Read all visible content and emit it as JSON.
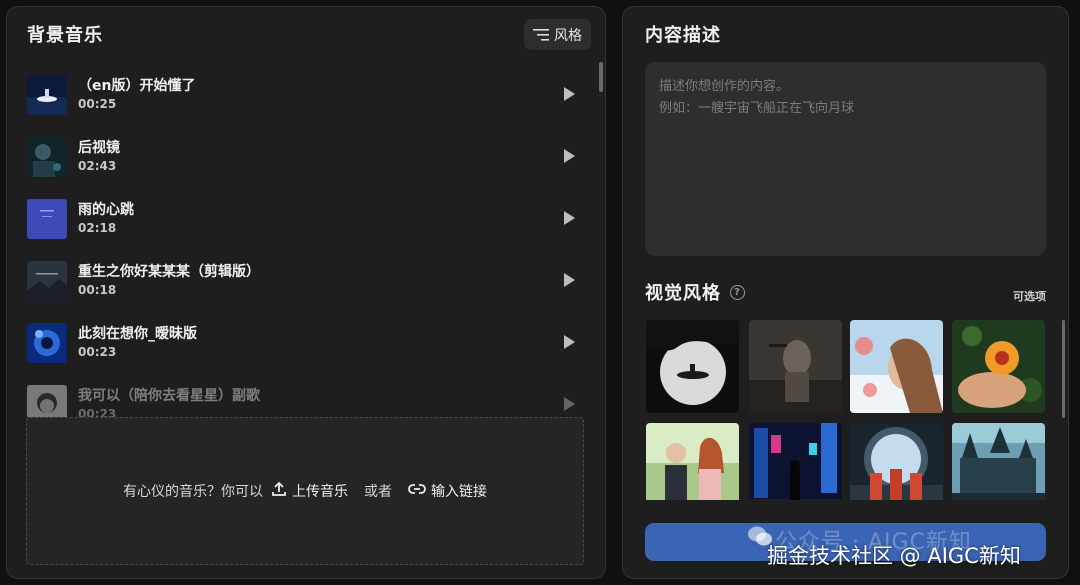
{
  "background_music": {
    "title": "背景音乐",
    "style_button_label": "风格",
    "items": [
      {
        "title": "（en版）开始懂了",
        "duration": "00:25"
      },
      {
        "title": "后视镜",
        "duration": "02:43"
      },
      {
        "title": "雨的心跳",
        "duration": "02:18"
      },
      {
        "title": "重生之你好某某某（剪辑版）",
        "duration": "00:18"
      },
      {
        "title": "此刻在想你_暧昧版",
        "duration": "00:23"
      },
      {
        "title": "我可以（陪你去看星星）副歌",
        "duration": "00:23"
      }
    ],
    "upload": {
      "prompt": "有心仪的音乐？你可以",
      "upload_label": "上传音乐",
      "or_label": "或者",
      "link_label": "输入链接"
    }
  },
  "content_description": {
    "title": "内容描述",
    "placeholder": "描述你想创作的内容。\n例如：一艘宇宙飞船正在飞向月球"
  },
  "visual_style": {
    "title": "视觉风格",
    "optional_label": "可选项"
  },
  "watermark": {
    "ghost_text": "公众号 · AIGC新知",
    "text": "掘金技术社区 @ AIGC新知"
  },
  "colors": {
    "accent": "#3a64b4",
    "panel_bg": "#1e1e1e",
    "page_bg": "#101010"
  }
}
